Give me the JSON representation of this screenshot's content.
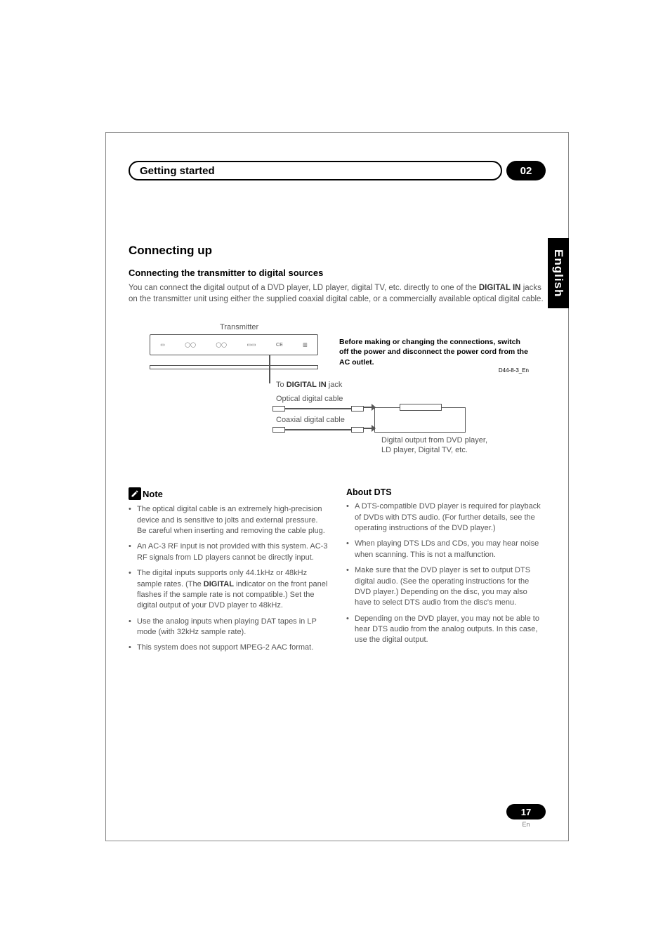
{
  "header": {
    "chapter_title": "Getting started",
    "chapter_number": "02"
  },
  "side_tab": "English",
  "main": {
    "h1": "Connecting up",
    "h2": "Connecting the transmitter to digital sources",
    "intro_pre": "You can connect the digital output of a DVD player, LD player, digital TV, etc. directly to one of the ",
    "intro_bold": "DIGITAL IN",
    "intro_post": " jacks on the transmitter unit using either the supplied coaxial digital cable, or a commercially available optical digital cable."
  },
  "diagram": {
    "transmitter_label": "Transmitter",
    "jack_label_pre": "To ",
    "jack_label_bold": "DIGITAL IN",
    "jack_label_post": " jack",
    "optical_label": "Optical digital cable",
    "coax_label": "Coaxial digital cable",
    "device_caption": "Digital output from DVD player, LD player, Digital TV, etc.",
    "warning_text": "Before making or changing the connections, switch off the power and disconnect the power cord from the AC outlet.",
    "warning_code": "D44-8-3_En"
  },
  "note": {
    "title": "Note",
    "items": [
      "The optical digital cable is an extremely high-precision device and is sensitive to jolts and external pressure. Be careful when inserting and removing the cable plug.",
      "An AC-3 RF input is not provided with this system. AC-3 RF signals from LD players cannot be directly input.",
      "",
      "Use the analog inputs when playing DAT tapes in LP mode (with 32kHz sample rate).",
      "This system does not support MPEG-2 AAC format."
    ],
    "item3_parts": {
      "pre": "The digital inputs supports only 44.1kHz or 48kHz sample rates. (The ",
      "bold": "DIGITAL",
      "post": " indicator on the front panel flashes if the sample rate is not compatible.) Set the digital output of your DVD player to 48kHz."
    }
  },
  "about": {
    "title": "About DTS",
    "items": [
      "A DTS-compatible DVD player is required for playback of DVDs with DTS audio. (For further details, see the operating instructions of the DVD player.)",
      "When playing DTS LDs and CDs, you may hear noise when scanning. This is not a malfunction.",
      "Make sure that the DVD player is set to output DTS digital audio. (See the operating instructions for the DVD player.) Depending on the disc, you may also have to select DTS audio from the disc's menu.",
      "Depending on the DVD player, you may not be able to hear DTS audio from the analog outputs. In this case, use the digital output."
    ]
  },
  "footer": {
    "page": "17",
    "lang": "En"
  }
}
